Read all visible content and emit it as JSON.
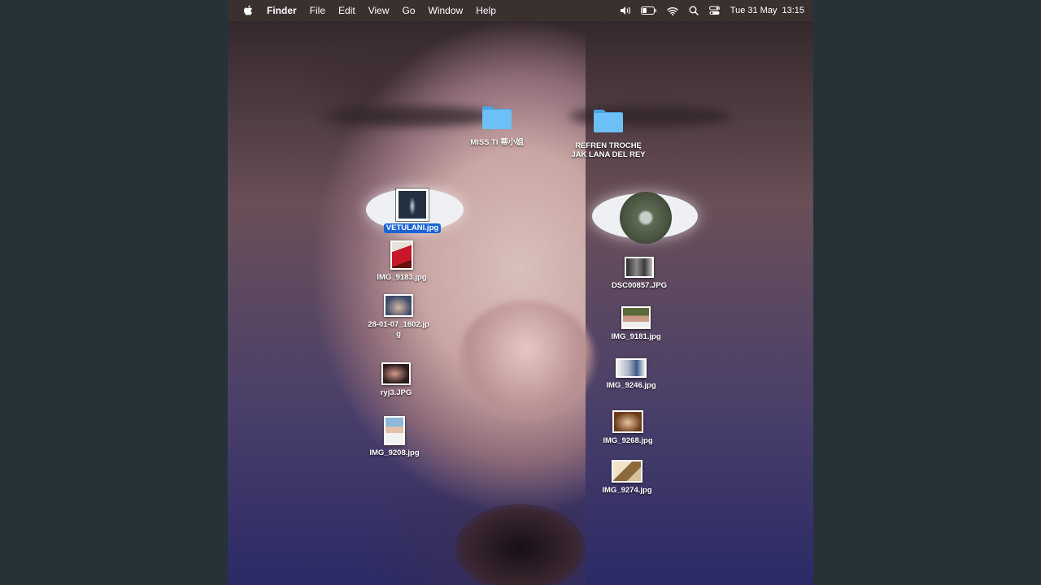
{
  "menubar": {
    "app_name": "Finder",
    "menus": [
      "File",
      "Edit",
      "View",
      "Go",
      "Window",
      "Help"
    ],
    "status_icons": [
      "volume-icon",
      "battery-icon",
      "wifi-icon",
      "spotlight-search-icon",
      "control-center-icon"
    ],
    "date": "Tue 31 May",
    "time": "13:15"
  },
  "desktop": {
    "folders": [
      {
        "label": "MISS TI 蒂小姐"
      },
      {
        "label": "REFREN TROCHĘ\nJAK LANA DEL REY"
      }
    ],
    "files": [
      {
        "label": "VETULANI.jpg",
        "selected": true
      },
      {
        "label": "IMG_9183.jpg"
      },
      {
        "label": "28-01-07_1602.jp\ng"
      },
      {
        "label": "ryj3.JPG"
      },
      {
        "label": "IMG_9208.jpg"
      },
      {
        "label": "DSC00857.JPG"
      },
      {
        "label": "IMG_9181.jpg"
      },
      {
        "label": "IMG_9246.jpg"
      },
      {
        "label": "IMG_9268.jpg"
      },
      {
        "label": "IMG_9274.jpg"
      }
    ]
  },
  "colors": {
    "selection": "#1b63d6",
    "folder": "#5fb4ef",
    "background_outside": "#253238"
  }
}
